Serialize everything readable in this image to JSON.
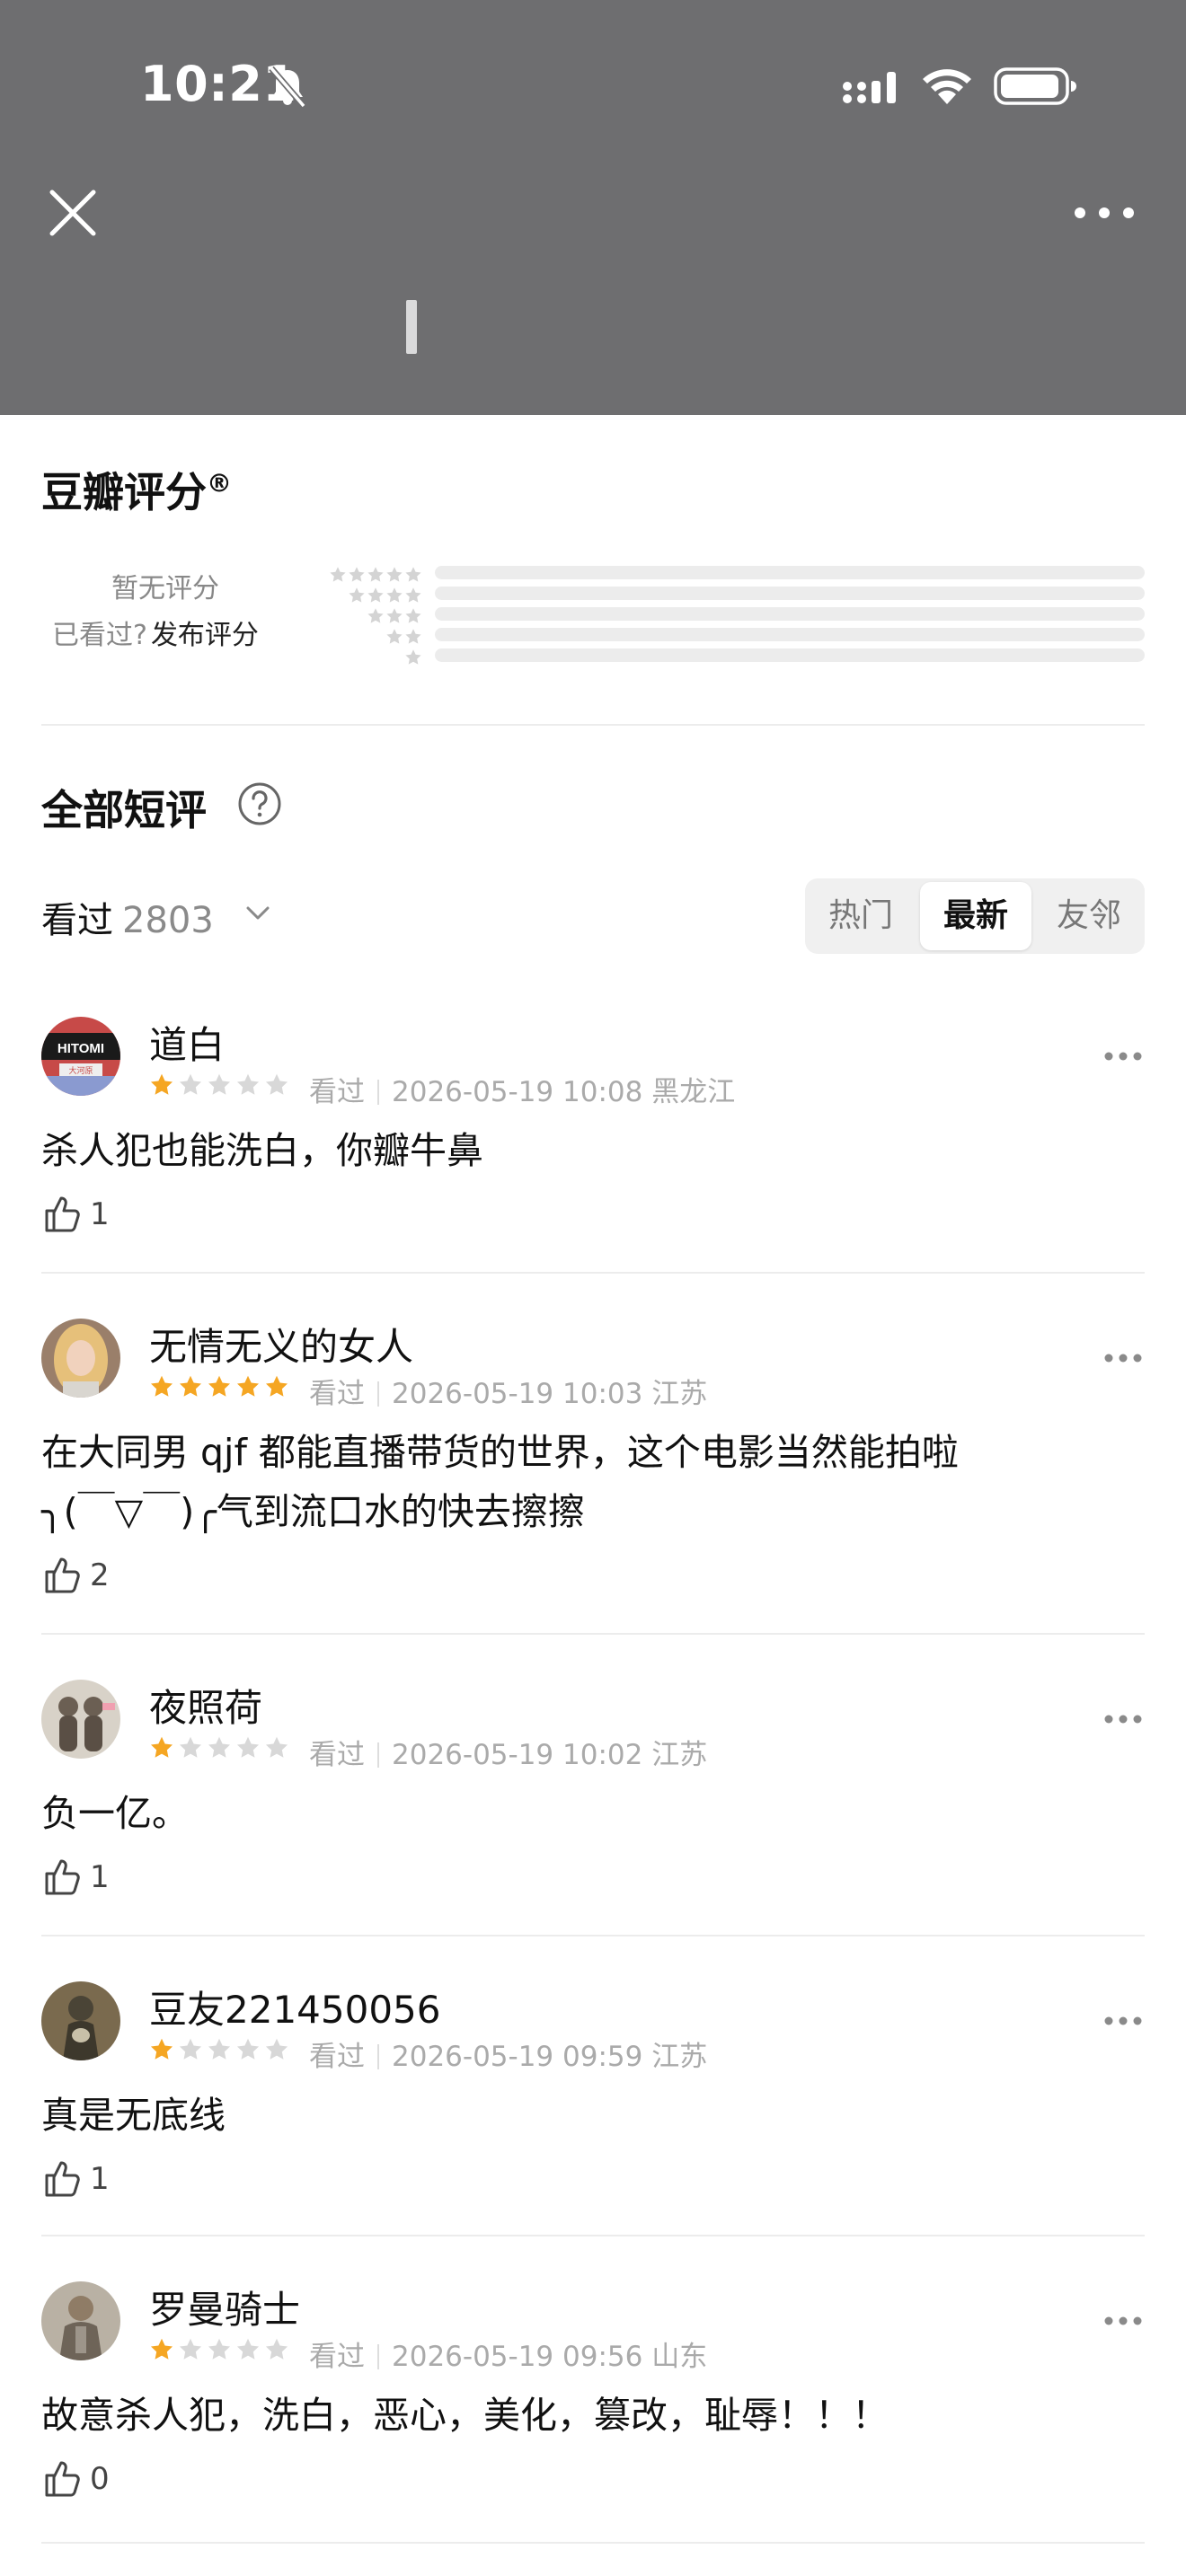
{
  "status": {
    "time": "10:21"
  },
  "rating": {
    "title": "豆瓣评分",
    "reg_mark": "®",
    "no_rating": "暂无评分",
    "seen_prompt": "已看过?",
    "publish": "发布评分"
  },
  "reviews": {
    "title": "全部短评",
    "filter_label": "看过",
    "filter_count": "2803",
    "tabs": [
      "热门",
      "最新",
      "友邻"
    ],
    "active_tab": "最新"
  },
  "comments": [
    {
      "user": "道白",
      "stars": 1,
      "status": "看过",
      "time": "2026-05-19 10:08",
      "location": "黑龙江",
      "lines": [
        "杀人犯也能洗白，你瓣牛鼻"
      ],
      "likes": "1"
    },
    {
      "user": "无情无义的女人",
      "stars": 5,
      "status": "看过",
      "time": "2026-05-19 10:03",
      "location": "江苏",
      "lines": [
        "在大同男 qjf 都能直播带货的世界，这个电影当然能拍啦",
        "╮(￣▽￣)╭气到流口水的快去擦擦"
      ],
      "likes": "2"
    },
    {
      "user": "夜照荷",
      "stars": 1,
      "status": "看过",
      "time": "2026-05-19 10:02",
      "location": "江苏",
      "lines": [
        "负一亿。"
      ],
      "likes": "1"
    },
    {
      "user": "豆友221450056",
      "stars": 1,
      "status": "看过",
      "time": "2026-05-19 09:59",
      "location": "江苏",
      "lines": [
        "真是无底线"
      ],
      "likes": "1"
    },
    {
      "user": "罗曼骑士",
      "stars": 1,
      "status": "看过",
      "time": "2026-05-19 09:56",
      "location": "山东",
      "lines": [
        "故意杀人犯，洗白，恶心，美化，篡改，耻辱！！！"
      ],
      "likes": "0"
    }
  ],
  "avatars": {
    "a0_text": "HITOMI",
    "a0_sub": "大河原"
  },
  "colors": {
    "star_on": "#f5a623",
    "star_off": "#d8d8d8",
    "header_bg": "#6e6e70"
  }
}
